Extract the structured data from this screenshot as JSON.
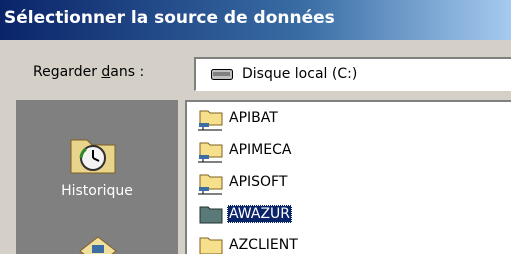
{
  "dialog": {
    "title": "Sélectionner la source de données"
  },
  "lookin": {
    "label": "Regarder dans :",
    "value": "Disque local (C:)",
    "icon": "drive-icon"
  },
  "places": [
    {
      "label": "Historique",
      "icon": "history-icon"
    },
    {
      "label": "",
      "icon": "desktop-icon"
    }
  ],
  "files": [
    {
      "name": "APIBAT",
      "icon": "network-folder-icon",
      "selected": false
    },
    {
      "name": "APIMECA",
      "icon": "network-folder-icon",
      "selected": false
    },
    {
      "name": "APISOFT",
      "icon": "network-folder-icon",
      "selected": false
    },
    {
      "name": "AWAZUR",
      "icon": "folder-icon",
      "selected": true
    },
    {
      "name": "AZCLIENT",
      "icon": "folder-icon",
      "selected": false
    }
  ],
  "colors": {
    "titlebar_start": "#0a246a",
    "titlebar_end": "#a6caf0",
    "selection": "#0a246a",
    "face": "#d4d0c8",
    "places_bg": "#808080"
  }
}
